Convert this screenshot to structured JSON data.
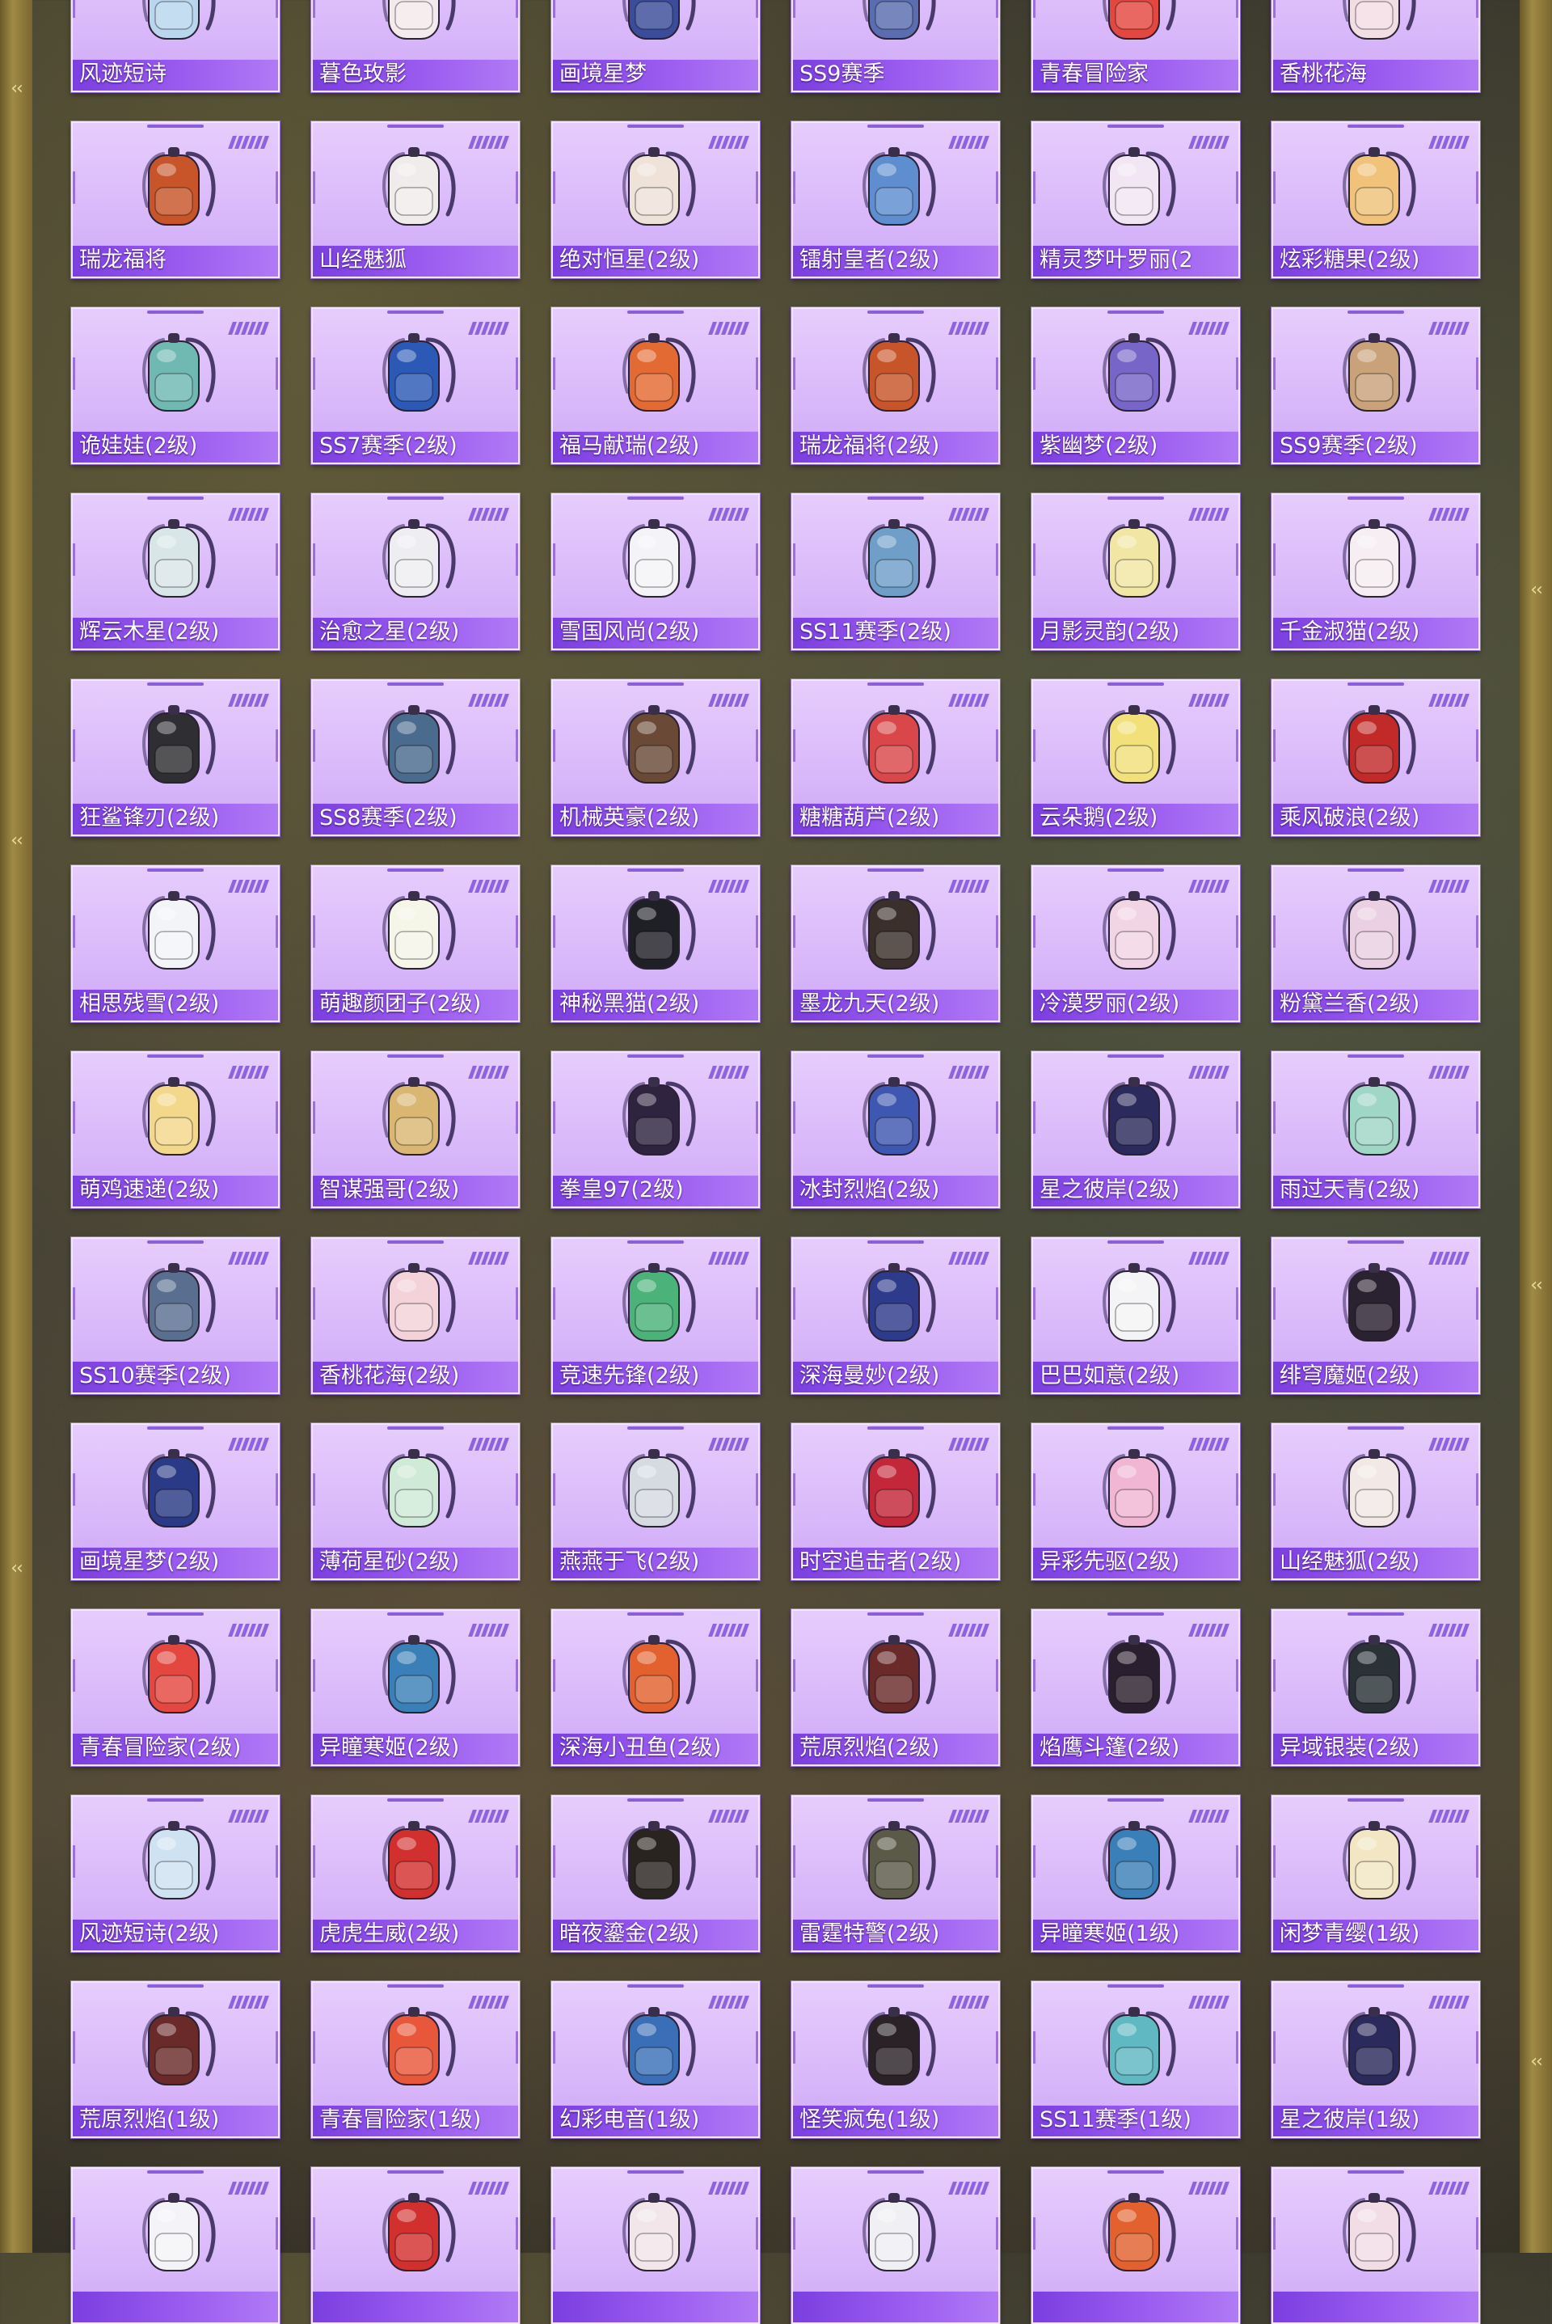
{
  "colors": {
    "card_bg": "#dcbcfb",
    "label_bar": "#8a4ee8",
    "label_text": "#ffffff",
    "frame_gold": "#a08a45"
  },
  "items": [
    {
      "name": "风迹短诗",
      "color": "#b9d6ee",
      "icon": "backpack-icon"
    },
    {
      "name": "暮色玫影",
      "color": "#f4e9ec",
      "icon": "backpack-icon"
    },
    {
      "name": "画境星梦",
      "color": "#3b4c9a",
      "icon": "backpack-icon"
    },
    {
      "name": "SS9赛季",
      "color": "#5a6db0",
      "icon": "backpack-icon"
    },
    {
      "name": "青春冒险家",
      "color": "#e4473f",
      "icon": "backpack-icon"
    },
    {
      "name": "香桃花海",
      "color": "#f3dde4",
      "icon": "backpack-icon"
    },
    {
      "name": "瑞龙福将",
      "color": "#c8552a",
      "icon": "backpack-icon"
    },
    {
      "name": "山经魅狐",
      "color": "#f1ecec",
      "icon": "backpack-icon"
    },
    {
      "name": "绝对恒星(2级)",
      "color": "#efe2d9",
      "icon": "backpack-icon"
    },
    {
      "name": "镭射皇者(2级)",
      "color": "#5e8ed0",
      "icon": "backpack-icon"
    },
    {
      "name": "精灵梦叶罗丽(2",
      "color": "#f2e6f4",
      "icon": "backpack-icon"
    },
    {
      "name": "炫彩糖果(2级)",
      "color": "#f0c27a",
      "icon": "backpack-icon"
    },
    {
      "name": "诡娃娃(2级)",
      "color": "#6fb9b2",
      "icon": "backpack-icon"
    },
    {
      "name": "SS7赛季(2级)",
      "color": "#2c59b5",
      "icon": "backpack-icon"
    },
    {
      "name": "福马献瑞(2级)",
      "color": "#e46a33",
      "icon": "backpack-icon"
    },
    {
      "name": "瑞龙福将(2级)",
      "color": "#c8552a",
      "icon": "backpack-icon"
    },
    {
      "name": "紫幽梦(2级)",
      "color": "#7865c8",
      "icon": "backpack-icon"
    },
    {
      "name": "SS9赛季(2级)",
      "color": "#c9a27a",
      "icon": "backpack-icon"
    },
    {
      "name": "辉云木星(2级)",
      "color": "#d9e6e8",
      "icon": "backpack-icon"
    },
    {
      "name": "治愈之星(2级)",
      "color": "#eeeef2",
      "icon": "backpack-icon"
    },
    {
      "name": "雪国风尚(2级)",
      "color": "#f4f4f8",
      "icon": "backpack-icon"
    },
    {
      "name": "SS11赛季(2级)",
      "color": "#6f9fc8",
      "icon": "backpack-icon"
    },
    {
      "name": "月影灵韵(2级)",
      "color": "#f1e6a4",
      "icon": "backpack-icon"
    },
    {
      "name": "千金淑猫(2级)",
      "color": "#f6eef2",
      "icon": "backpack-icon"
    },
    {
      "name": "狂鲨锋刃(2级)",
      "color": "#2f2f33",
      "icon": "backpack-icon"
    },
    {
      "name": "SS8赛季(2级)",
      "color": "#4a6b8d",
      "icon": "backpack-icon"
    },
    {
      "name": "机械英豪(2级)",
      "color": "#6a4a36",
      "icon": "backpack-icon"
    },
    {
      "name": "糖糖葫芦(2级)",
      "color": "#d9474a",
      "icon": "backpack-icon"
    },
    {
      "name": "云朵鹅(2级)",
      "color": "#f2e07b",
      "icon": "backpack-icon"
    },
    {
      "name": "乘风破浪(2级)",
      "color": "#c22a2a",
      "icon": "backpack-icon"
    },
    {
      "name": "相思残雪(2级)",
      "color": "#f2f4f8",
      "icon": "backpack-icon"
    },
    {
      "name": "萌趣颜团子(2级)",
      "color": "#f5f5e8",
      "icon": "backpack-icon"
    },
    {
      "name": "神秘黑猫(2级)",
      "color": "#1f1f26",
      "icon": "backpack-icon"
    },
    {
      "name": "墨龙九天(2级)",
      "color": "#3a2f2a",
      "icon": "backpack-icon"
    },
    {
      "name": "冷漠罗丽(2级)",
      "color": "#f2d5e4",
      "icon": "backpack-icon"
    },
    {
      "name": "粉黛兰香(2级)",
      "color": "#ead0e2",
      "icon": "backpack-icon"
    },
    {
      "name": "萌鸡速递(2级)",
      "color": "#f3d78a",
      "icon": "backpack-icon"
    },
    {
      "name": "智谋强哥(2级)",
      "color": "#d9b772",
      "icon": "backpack-icon"
    },
    {
      "name": "拳皇97(2级)",
      "color": "#2e2440",
      "icon": "backpack-icon"
    },
    {
      "name": "冰封烈焰(2级)",
      "color": "#3e57b0",
      "icon": "backpack-icon"
    },
    {
      "name": "星之彼岸(2级)",
      "color": "#2b2a5c",
      "icon": "backpack-icon"
    },
    {
      "name": "雨过天青(2级)",
      "color": "#9fd6c6",
      "icon": "backpack-icon"
    },
    {
      "name": "SS10赛季(2级)",
      "color": "#5a6f90",
      "icon": "backpack-icon"
    },
    {
      "name": "香桃花海(2级)",
      "color": "#f3d2da",
      "icon": "backpack-icon"
    },
    {
      "name": "竞速先锋(2级)",
      "color": "#4bb37a",
      "icon": "backpack-icon"
    },
    {
      "name": "深海曼妙(2级)",
      "color": "#2e3a8a",
      "icon": "backpack-icon"
    },
    {
      "name": "巴巴如意(2级)",
      "color": "#f4f4f6",
      "icon": "backpack-icon"
    },
    {
      "name": "绯穹魔姬(2级)",
      "color": "#2a2230",
      "icon": "backpack-icon"
    },
    {
      "name": "画境星梦(2级)",
      "color": "#2a3a86",
      "icon": "backpack-icon"
    },
    {
      "name": "薄荷星砂(2级)",
      "color": "#cfead6",
      "icon": "backpack-icon"
    },
    {
      "name": "燕燕于飞(2级)",
      "color": "#d6dbe2",
      "icon": "backpack-icon"
    },
    {
      "name": "时空追击者(2级)",
      "color": "#c2273a",
      "icon": "backpack-icon"
    },
    {
      "name": "异彩先驱(2级)",
      "color": "#f0b6d4",
      "icon": "backpack-icon"
    },
    {
      "name": "山经魅狐(2级)",
      "color": "#f2e8e6",
      "icon": "backpack-icon"
    },
    {
      "name": "青春冒险家(2级)",
      "color": "#e4473f",
      "icon": "backpack-icon"
    },
    {
      "name": "异瞳寒姬(2级)",
      "color": "#3b7fb8",
      "icon": "backpack-icon"
    },
    {
      "name": "深海小丑鱼(2级)",
      "color": "#e2612e",
      "icon": "backpack-icon"
    },
    {
      "name": "荒原烈焰(2级)",
      "color": "#6a2a2a",
      "icon": "backpack-icon"
    },
    {
      "name": "焰鹰斗篷(2级)",
      "color": "#2a1f2e",
      "icon": "backpack-icon"
    },
    {
      "name": "异域银装(2级)",
      "color": "#2a3238",
      "icon": "backpack-icon"
    },
    {
      "name": "风迹短诗(2级)",
      "color": "#cfe2f2",
      "icon": "backpack-icon"
    },
    {
      "name": "虎虎生威(2级)",
      "color": "#d2302e",
      "icon": "backpack-icon"
    },
    {
      "name": "暗夜鎏金(2级)",
      "color": "#2a2420",
      "icon": "backpack-icon"
    },
    {
      "name": "雷霆特警(2级)",
      "color": "#5b5a48",
      "icon": "backpack-icon"
    },
    {
      "name": "异瞳寒姬(1级)",
      "color": "#3b7fb8",
      "icon": "backpack-icon"
    },
    {
      "name": "闲梦青缨(1级)",
      "color": "#f2e6c4",
      "icon": "backpack-icon"
    },
    {
      "name": "荒原烈焰(1级)",
      "color": "#6a2a2a",
      "icon": "backpack-icon"
    },
    {
      "name": "青春冒险家(1级)",
      "color": "#e9573a",
      "icon": "backpack-icon"
    },
    {
      "name": "幻彩电音(1级)",
      "color": "#3a6fb8",
      "icon": "backpack-icon"
    },
    {
      "name": "怪笑疯兔(1级)",
      "color": "#2a2226",
      "icon": "backpack-icon"
    },
    {
      "name": "SS11赛季(1级)",
      "color": "#5fb8c2",
      "icon": "backpack-icon"
    },
    {
      "name": "星之彼岸(1级)",
      "color": "#2b2a5c",
      "icon": "backpack-icon"
    },
    {
      "name": "",
      "color": "#f4f4f8",
      "icon": "backpack-icon"
    },
    {
      "name": "",
      "color": "#d2302e",
      "icon": "backpack-icon"
    },
    {
      "name": "",
      "color": "#f2e6ea",
      "icon": "backpack-icon"
    },
    {
      "name": "",
      "color": "#f0f0f4",
      "icon": "backpack-icon"
    },
    {
      "name": "",
      "color": "#e2612e",
      "icon": "backpack-icon"
    },
    {
      "name": "",
      "color": "#f2dde6",
      "icon": "backpack-icon"
    }
  ]
}
